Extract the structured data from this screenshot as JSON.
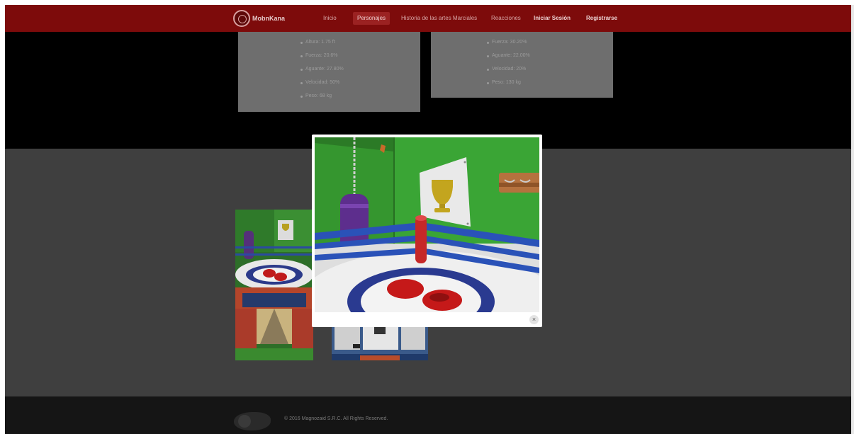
{
  "navbar": {
    "logo_text": "MobnKana",
    "items": [
      {
        "label": "Inicio"
      },
      {
        "label": "Personajes"
      },
      {
        "label": "Historia de las artes Marciales"
      },
      {
        "label": "Reacciones"
      },
      {
        "label": "Iniciar Sesión"
      },
      {
        "label": "Registrarse"
      }
    ]
  },
  "cards": {
    "left": [
      "Altura: 1.75 ft",
      "Fuerza: 20.6%",
      "Aguante: 27.80%",
      "Velocidad: 50%",
      "Peso: 68 kg"
    ],
    "right": [
      "Fuerza: 30.20%",
      "Aguante: 22.00%",
      "Velocidad: 20%",
      "Peso: 130 kg"
    ]
  },
  "modal": {
    "close_label": "×"
  },
  "footer": {
    "copyright": "© 2016 Magnozaid S.R.C. All Rights Reserved."
  },
  "colors": {
    "navbar": "#7d0b0b",
    "overlay_dark": "#000000",
    "overlay_gray": "#3f3f3f",
    "footer": "#151515"
  }
}
